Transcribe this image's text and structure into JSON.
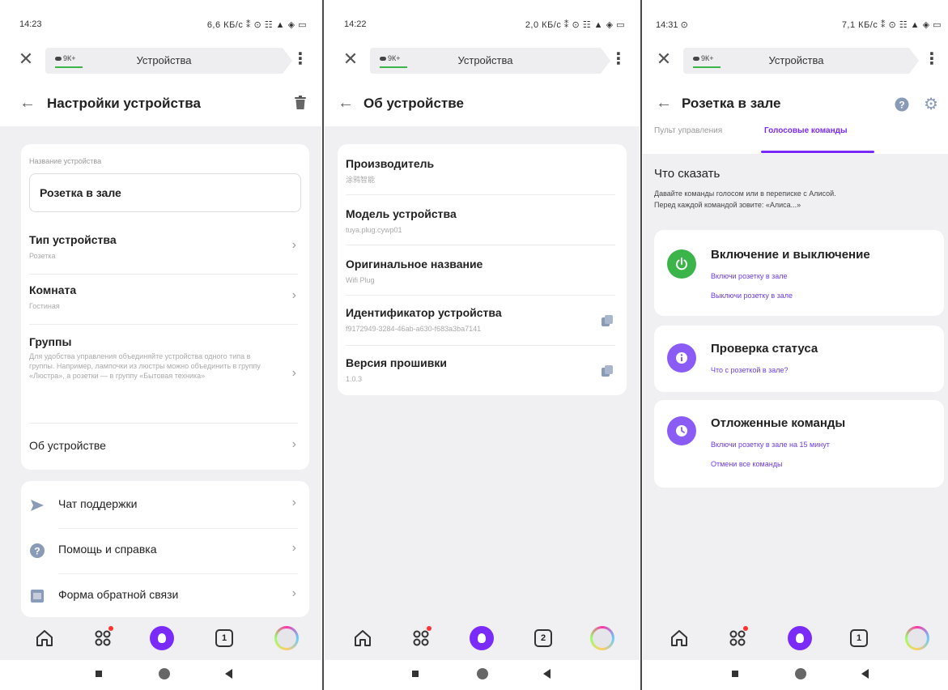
{
  "screens": [
    {
      "status": {
        "time": "14:23",
        "indicators": "6,6 КБ/с ⁑ ⊙ ☷ ▲ ◈ ▭"
      },
      "browser": {
        "weather": "9К+",
        "title": "Устройства"
      },
      "header": {
        "title": "Настройки устройства"
      },
      "name_card": {
        "label": "Название устройства",
        "value": "Розетка в зале"
      },
      "settings": [
        {
          "title": "Тип устройства",
          "subtitle": "Розетка"
        },
        {
          "title": "Комната",
          "subtitle": "Гостиная"
        },
        {
          "title": "Группы",
          "subtitle": "Для удобства управления объединяйте устройства одного типа в группы. Например, лампочки из люстры можно объединить в группу «Люстра», а розетки — в группу «Бытовая техника»"
        },
        {
          "title": "Об устройстве",
          "subtitle": ""
        }
      ],
      "support": [
        {
          "label": "Чат поддержки",
          "icon": "send-icon"
        },
        {
          "label": "Помощь и справка",
          "icon": "help-icon"
        },
        {
          "label": "Форма обратной связи",
          "icon": "feedback-form-icon"
        }
      ],
      "tabs_count": "1"
    },
    {
      "status": {
        "time": "14:22",
        "indicators": "2,0 КБ/с ⁑ ⊙ ☷ ▲ ◈ ▭"
      },
      "browser": {
        "weather": "9К+",
        "title": "Устройства"
      },
      "header": {
        "title": "Об устройстве"
      },
      "info": [
        {
          "title": "Производитель",
          "value": "涂鸦智能",
          "copy": false
        },
        {
          "title": "Модель устройства",
          "value": "tuya.plug.cywp01",
          "copy": false
        },
        {
          "title": "Оригинальное название",
          "value": "Wifi Plug",
          "copy": false
        },
        {
          "title": "Идентификатор устройства",
          "value": "f9172949-3284-46ab-a630-f683a3ba7141",
          "copy": true
        },
        {
          "title": "Версия прошивки",
          "value": "1.0.3",
          "copy": true
        }
      ],
      "tabs_count": "2"
    },
    {
      "status": {
        "time": "14:31 ⊙",
        "indicators": "7,1 КБ/с ⁑ ⊙ ☷ ▲ ◈ ▭"
      },
      "browser": {
        "weather": "9К+",
        "title": "Устройства"
      },
      "header": {
        "title": "Розетка в зале"
      },
      "tabs": {
        "remote": "Пульт управления",
        "voice": "Голосовые команды"
      },
      "intro": {
        "title": "Что сказать",
        "text_1": "Давайте команды голосом или в переписке с Алисой.",
        "text_2": "Перед каждой командой зовите: «Алиса...»"
      },
      "commands": [
        {
          "title": "Включение и выключение",
          "icon": "power-icon",
          "color": "#3bb54a",
          "links": [
            "Включи розетку в зале",
            "Выключи розетку в зале"
          ]
        },
        {
          "title": "Проверка статуса",
          "icon": "info-icon",
          "color": "#8a5cf5",
          "links": [
            "Что с розеткой в зале?"
          ]
        },
        {
          "title": "Отложенные команды",
          "icon": "clock-icon",
          "color": "#8a5cf5",
          "links": [
            "Включи розетку в зале на 15 минут",
            "Отмени все команды"
          ]
        }
      ],
      "tabs_count": "1"
    }
  ],
  "colors": {
    "accent": "#7b2bf9",
    "link": "#6a3ce0",
    "green": "#3bb54a"
  }
}
